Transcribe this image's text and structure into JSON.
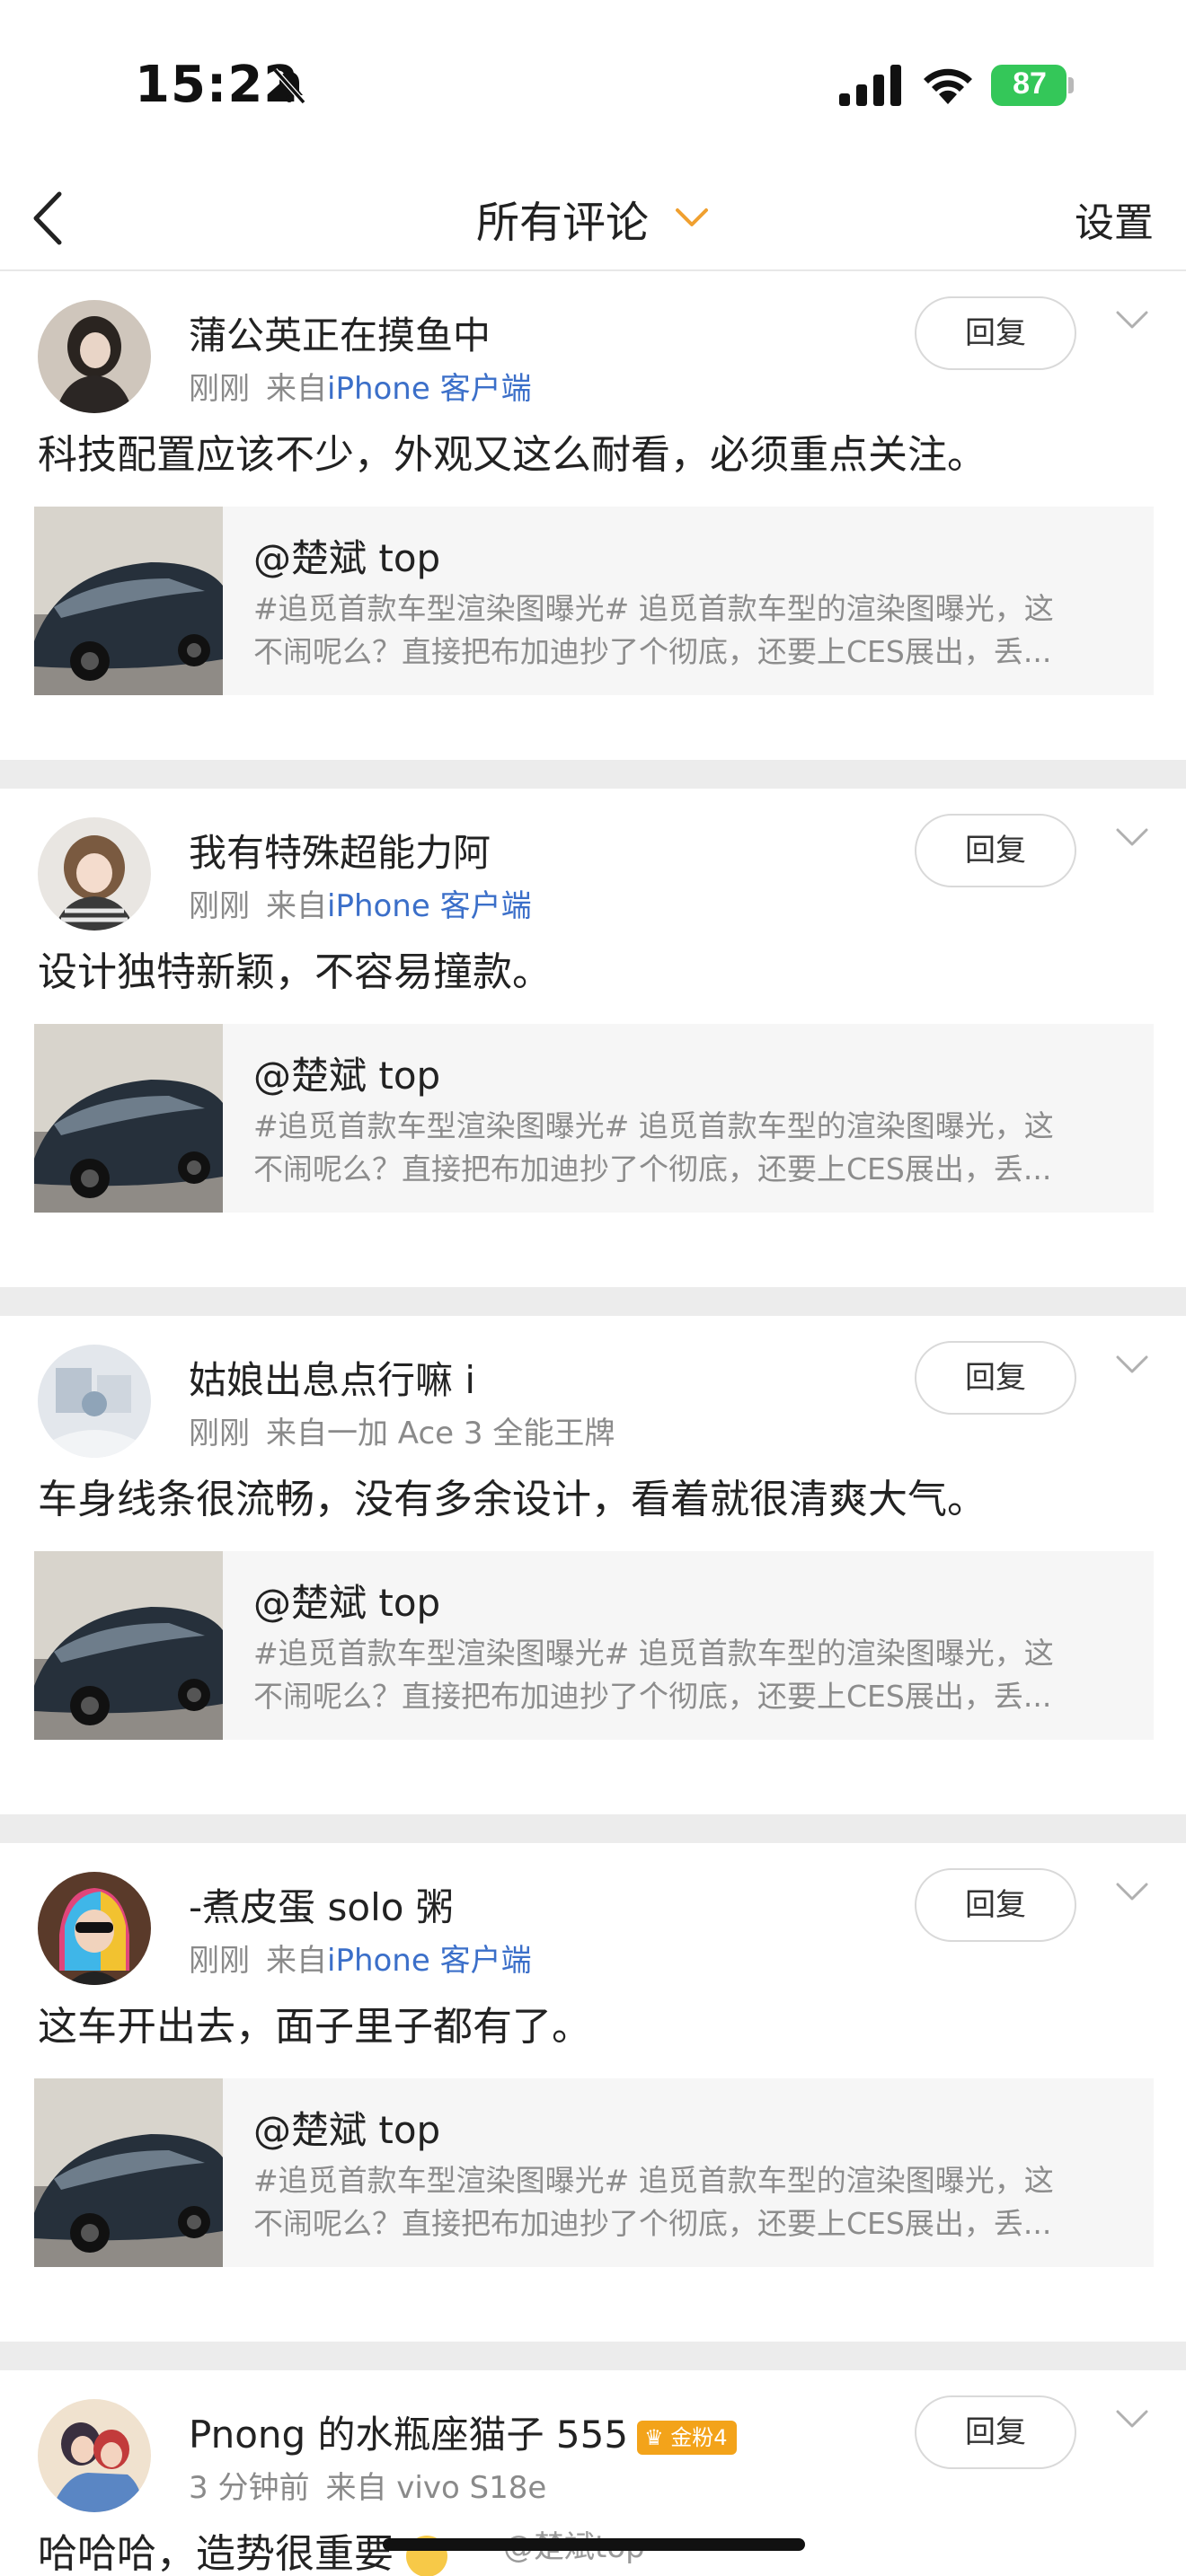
{
  "status_bar": {
    "time": "15:22",
    "battery": "87",
    "icons": [
      "bell-slash-icon",
      "cellular-signal-icon",
      "wifi-icon",
      "battery-charging-icon"
    ]
  },
  "nav": {
    "back_icon": "chevron-left-icon",
    "title": "所有评论",
    "title_icon": "chevron-down-icon",
    "title_icon_color": "#f0a030",
    "settings": "设置"
  },
  "reply_label": "回复",
  "comments": [
    {
      "username": "蒲公英正在摸鱼中",
      "time": "刚刚",
      "from": "来自",
      "source": "iPhone 客户端",
      "text": "科技配置应该不少，外观又这么耐看，必须重点关注。",
      "card": {
        "title": "@楚斌 top",
        "line1": "#追觅首款车型渲染图曝光#  追觅首款车型的渲染图曝光，这",
        "line2": "不闹呢么？直接把布加迪抄了个彻底，还要上CES展出，丢..."
      }
    },
    {
      "username": "我有特殊超能力阿",
      "time": "刚刚",
      "from": "来自",
      "source": "iPhone 客户端",
      "text": " 设计独特新颖，不容易撞款。",
      "card": {
        "title": "@楚斌 top",
        "line1": "#追觅首款车型渲染图曝光#  追觅首款车型的渲染图曝光，这",
        "line2": "不闹呢么？直接把布加迪抄了个彻底，还要上CES展出，丢..."
      }
    },
    {
      "username": "姑娘出息点行嘛 i",
      "time": "刚刚",
      "from": "来自一加 Ace 3 全能王牌",
      "source": "",
      "text": "车身线条很流畅，没有多余设计，看着就很清爽大气。",
      "card": {
        "title": "@楚斌 top",
        "line1": "#追觅首款车型渲染图曝光#  追觅首款车型的渲染图曝光，这",
        "line2": "不闹呢么？直接把布加迪抄了个彻底，还要上CES展出，丢..."
      }
    },
    {
      "username": "-煮皮蛋 solo 粥",
      "time": "刚刚",
      "from": "来自",
      "source": "iPhone 客户端",
      "text": "这车开出去，面子里子都有了。",
      "card": {
        "title": "@楚斌 top",
        "line1": "#追觅首款车型渲染图曝光#  追觅首款车型的渲染图曝光，这",
        "line2": "不闹呢么？直接把布加迪抄了个彻底，还要上CES展出，丢..."
      }
    },
    {
      "username": "Pnong 的水瓶座猫子 555",
      "badge": "金粉4",
      "time": "3 分钟前",
      "from": "来自 vivo S18e",
      "source": "",
      "text": "哈哈哈，造势很重要"
    }
  ],
  "watermark": "@楚斌top"
}
